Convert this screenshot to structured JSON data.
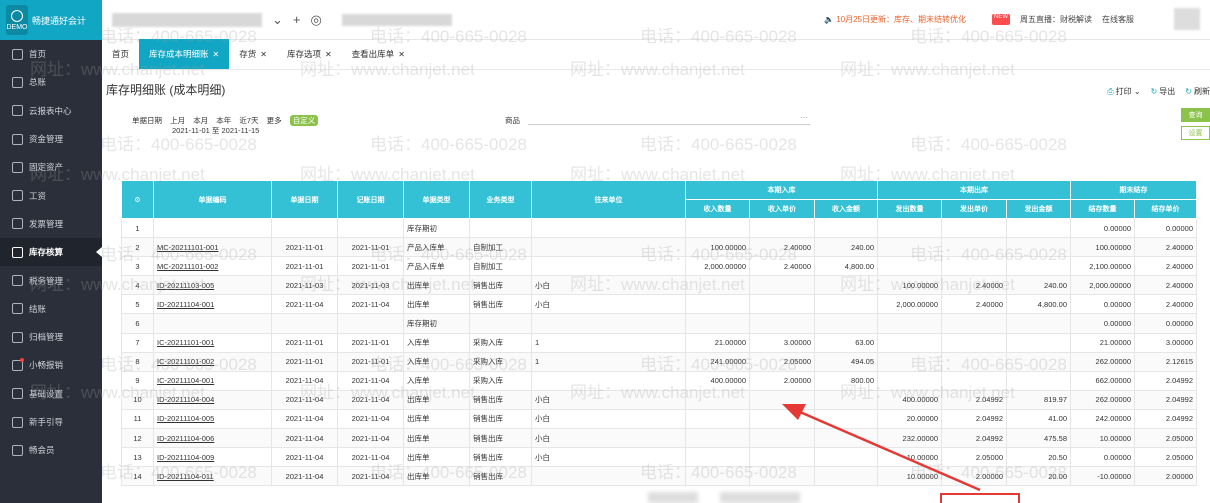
{
  "sidebar": {
    "brand": "畅捷通好会计",
    "brand_sub": "DEMO",
    "items": [
      {
        "label": "首页",
        "icon": "home-icon"
      },
      {
        "label": "总账",
        "icon": "ledger-icon"
      },
      {
        "label": "云报表中心",
        "icon": "report-icon"
      },
      {
        "label": "资金管理",
        "icon": "fund-icon"
      },
      {
        "label": "固定资产",
        "icon": "asset-icon"
      },
      {
        "label": "工资",
        "icon": "salary-icon"
      },
      {
        "label": "发票管理",
        "icon": "invoice-icon"
      },
      {
        "label": "库存核算",
        "icon": "inventory-icon",
        "active": true
      },
      {
        "label": "税务管理",
        "icon": "tax-icon"
      },
      {
        "label": "结账",
        "icon": "close-book-icon"
      },
      {
        "label": "归档管理",
        "icon": "archive-icon"
      },
      {
        "label": "小畅报销",
        "icon": "expense-icon"
      },
      {
        "label": "基础设置",
        "icon": "settings-icon"
      },
      {
        "label": "新手引导",
        "icon": "guide-icon"
      },
      {
        "label": "畅会员",
        "icon": "vip-icon"
      }
    ]
  },
  "topbar": {
    "notice": "10月25日更新：库存、期末结转优化",
    "items": [
      "周五直播：财税解读",
      "在线客服"
    ]
  },
  "tabs": [
    {
      "label": "首页",
      "closable": false
    },
    {
      "label": "库存成本明细账",
      "closable": true,
      "active": true
    },
    {
      "label": "存货",
      "closable": true
    },
    {
      "label": "库存选项",
      "closable": true
    },
    {
      "label": "查看出库单",
      "closable": true
    }
  ],
  "page": {
    "title": "库存明细账 (成本明细)",
    "actions": {
      "print": "打印",
      "export": "导出",
      "refresh": "刷新"
    }
  },
  "filters": {
    "date_label": "单据日期",
    "periods": [
      "上月",
      "本月",
      "本年",
      "近7天",
      "更多"
    ],
    "custom": "自定义",
    "range": "2021-11-01 至 2021-11-15",
    "goods_label": "商品",
    "query_btn": "查询",
    "settings_btn": "设置"
  },
  "table": {
    "headers": {
      "seq": "",
      "doc_no": "单据编码",
      "doc_date": "单据日期",
      "post_date": "记账日期",
      "doc_type": "单据类型",
      "biz_type": "业务类型",
      "partner": "往来单位",
      "in_group": "本期入库",
      "out_group": "本期出库",
      "end_group": "期末结存",
      "in_qty": "收入数量",
      "in_price": "收入单价",
      "in_amt": "收入金额",
      "out_qty": "发出数量",
      "out_price": "发出单价",
      "out_amt": "发出金额",
      "end_qty": "结存数量",
      "end_price": "结存单价"
    },
    "rows": [
      [
        "1",
        "",
        "",
        "",
        "库存期初",
        "",
        "",
        "",
        "",
        "",
        "",
        "",
        "",
        "0.00000",
        "0.00000"
      ],
      [
        "2",
        "MC-20211101-001",
        "2021-11-01",
        "2021-11-01",
        "产品入库单",
        "自制加工",
        "",
        "100.00000",
        "2.40000",
        "240.00",
        "",
        "",
        "",
        "100.00000",
        "2.40000"
      ],
      [
        "3",
        "MC-20211101-002",
        "2021-11-01",
        "2021-11-01",
        "产品入库单",
        "自制加工",
        "",
        "2,000.00000",
        "2.40000",
        "4,800.00",
        "",
        "",
        "",
        "2,100.00000",
        "2.40000"
      ],
      [
        "4",
        "ID-20211103-005",
        "2021-11-03",
        "2021-11-03",
        "出库单",
        "销售出库",
        "小白",
        "",
        "",
        "",
        "100.00000",
        "2.40000",
        "240.00",
        "2,000.00000",
        "2.40000"
      ],
      [
        "5",
        "ID-20211104-001",
        "2021-11-04",
        "2021-11-04",
        "出库单",
        "销售出库",
        "小白",
        "",
        "",
        "",
        "2,000.00000",
        "2.40000",
        "4,800.00",
        "0.00000",
        "2.40000"
      ],
      [
        "6",
        "",
        "",
        "",
        "库存期初",
        "",
        "",
        "",
        "",
        "",
        "",
        "",
        "",
        "0.00000",
        "0.00000"
      ],
      [
        "7",
        "IC-20211101-001",
        "2021-11-01",
        "2021-11-01",
        "入库单",
        "采购入库",
        "1",
        "21.00000",
        "3.00000",
        "63.00",
        "",
        "",
        "",
        "21.00000",
        "3.00000"
      ],
      [
        "8",
        "IC-20211101-002",
        "2021-11-01",
        "2021-11-01",
        "入库单",
        "采购入库",
        "1",
        "241.00000",
        "2.05000",
        "494.05",
        "",
        "",
        "",
        "262.00000",
        "2.12615"
      ],
      [
        "9",
        "IC-20211104-001",
        "2021-11-04",
        "2021-11-04",
        "入库单",
        "采购入库",
        "",
        "400.00000",
        "2.00000",
        "800.00",
        "",
        "",
        "",
        "662.00000",
        "2.04992"
      ],
      [
        "10",
        "ID-20211104-004",
        "2021-11-04",
        "2021-11-04",
        "出库单",
        "销售出库",
        "小白",
        "",
        "",
        "",
        "400.00000",
        "2.04992",
        "819.97",
        "262.00000",
        "2.04992"
      ],
      [
        "11",
        "ID-20211104-005",
        "2021-11-04",
        "2021-11-04",
        "出库单",
        "销售出库",
        "小白",
        "",
        "",
        "",
        "20.00000",
        "2.04992",
        "41.00",
        "242.00000",
        "2.04992"
      ],
      [
        "12",
        "ID-20211104-006",
        "2021-11-04",
        "2021-11-04",
        "出库单",
        "销售出库",
        "小白",
        "",
        "",
        "",
        "232.00000",
        "2.04992",
        "475.58",
        "10.00000",
        "2.05000"
      ],
      [
        "13",
        "ID-20211104-009",
        "2021-11-04",
        "2021-11-04",
        "出库单",
        "销售出库",
        "小白",
        "",
        "",
        "",
        "10.00000",
        "2.05000",
        "20.50",
        "0.00000",
        "2.05000"
      ],
      [
        "14",
        "ID-20211104-011",
        "2021-11-04",
        "2021-11-04",
        "出库单",
        "销售出库",
        "",
        "",
        "",
        "",
        "10.00000",
        "2.00000",
        "20.00",
        "-10.00000",
        "2.00000"
      ]
    ]
  },
  "watermark": {
    "phone": "电话：400-665-0028",
    "site": "网址：www.chanjet.net"
  },
  "colors": {
    "accent": "#11a7c4",
    "header": "#34c1d6",
    "sidebar": "#2b2f3a",
    "annotation": "#e53935",
    "green": "#8bc34a"
  }
}
